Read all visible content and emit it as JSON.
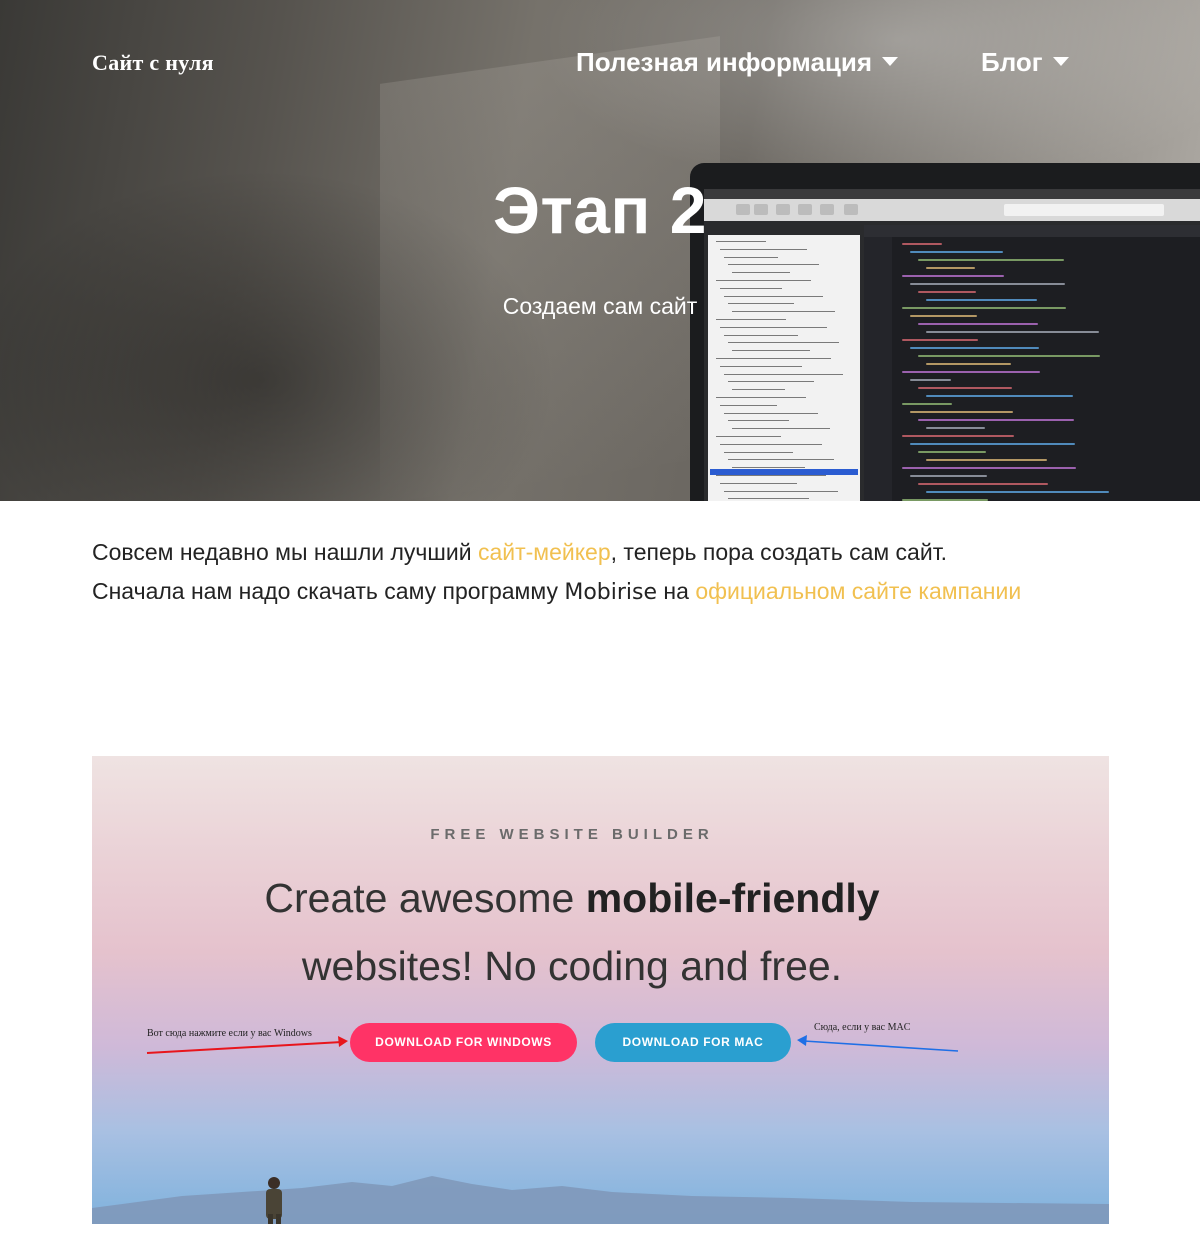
{
  "nav": {
    "brand": "Сайт с нуля",
    "items": [
      {
        "label": "Полезная информация"
      },
      {
        "label": "Блог"
      }
    ]
  },
  "hero": {
    "title": "Этап 2",
    "subtitle": "Создаем сам сайт"
  },
  "intro": {
    "line1_before": "Совсем недавно мы нашли лучший ",
    "line1_link": "сайт-мейкер",
    "line1_after": ", теперь пора создать сам сайт.",
    "line2_before": "Сначала нам надо скачать саму программу ",
    "line2_brand": "Mobirise",
    "line2_mid": " на ",
    "line2_link": "официальном сайте кампании"
  },
  "banner": {
    "eyebrow": "FREE WEBSITE BUILDER",
    "headline_before": "Create awesome ",
    "headline_bold": "mobile-friendly",
    "headline_line2": "websites! No coding and free.",
    "btn_windows": "DOWNLOAD FOR WINDOWS",
    "btn_mac": "DOWNLOAD FOR MAC",
    "note_windows": "Вот сюда нажмите если у вас Windows",
    "note_mac": "Сюда, если у вас MAC"
  },
  "colors": {
    "link": "#f1c050",
    "btn_windows": "#ff3366",
    "btn_mac": "#2a9fd0",
    "arrow_windows": "#e8151c",
    "arrow_mac": "#1f6fe6"
  },
  "icons": {
    "caret": "chevron-down-icon"
  }
}
